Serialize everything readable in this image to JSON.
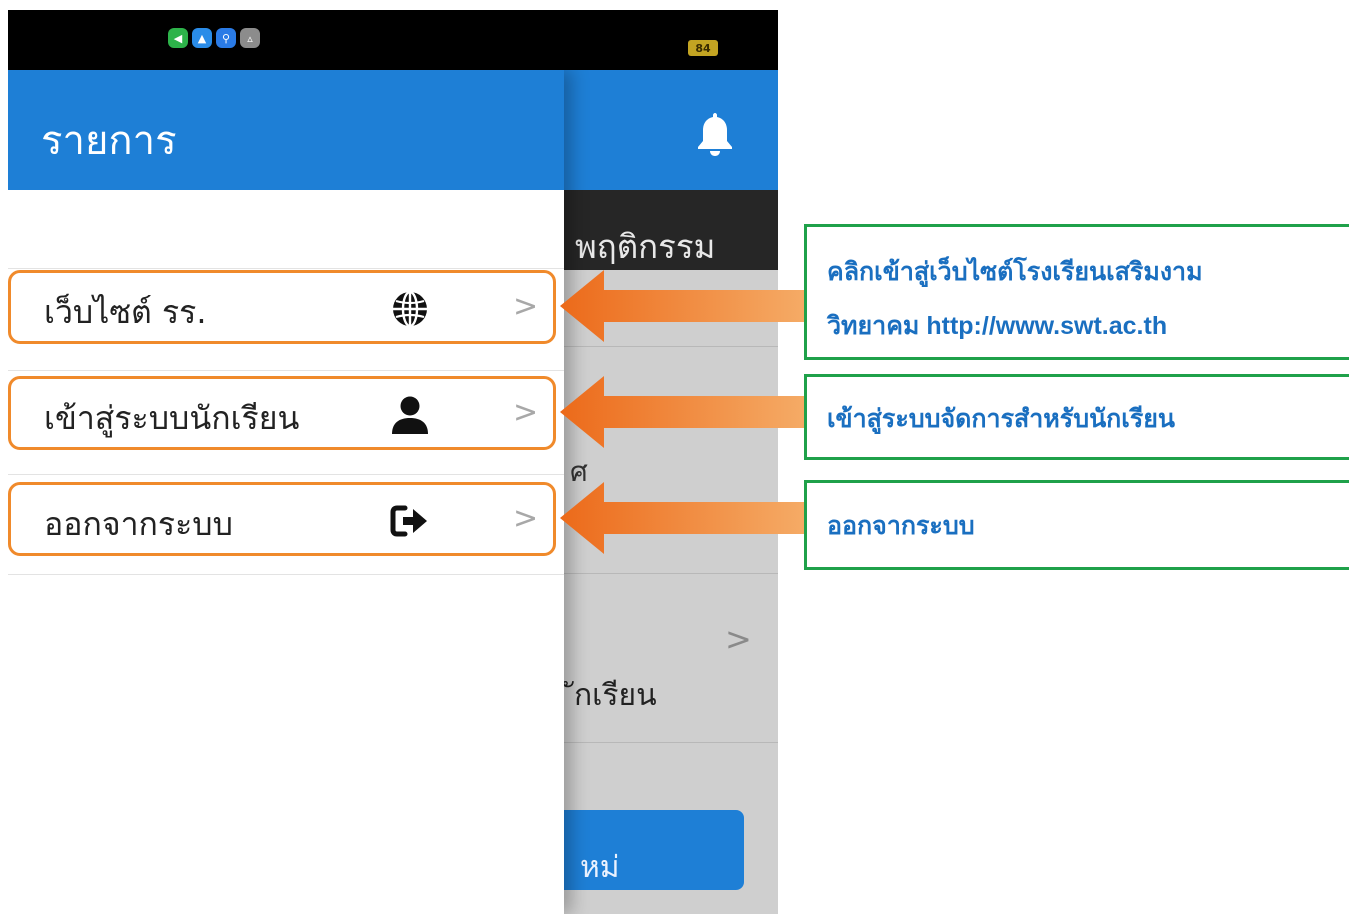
{
  "status_bar": {
    "app_icons": [
      "messages-icon",
      "maps-icon",
      "usb-icon",
      "store-icon"
    ],
    "battery": "84"
  },
  "drawer": {
    "title": "รายการ",
    "items": [
      {
        "label": "เว็บไซต์ รร.",
        "icon": "globe-icon"
      },
      {
        "label": "เข้าสู่ระบบนักเรียน",
        "icon": "user-icon"
      },
      {
        "label": "ออกจากระบบ",
        "icon": "sign-out-icon"
      }
    ]
  },
  "background_app": {
    "tab_label": "พฤติกรรม",
    "partial_text_1": "ศ",
    "partial_text_2": "ักเรียน",
    "button_label": "หม่"
  },
  "annotations": [
    {
      "line1": "คลิกเข้าสู่เว็บไซต์โรงเรียนเสริมงาม",
      "line2": "วิทยาคม http://www.swt.ac.th"
    },
    {
      "line1": "เข้าสู่ระบบจัดการสำหรับนักเรียน"
    },
    {
      "line1": "ออกจากระบบ"
    }
  ],
  "colors": {
    "header_blue": "#1e7fd6",
    "highlight_orange": "#f08a2b",
    "callout_border": "#1fa14a",
    "callout_text": "#1a6fc0"
  }
}
